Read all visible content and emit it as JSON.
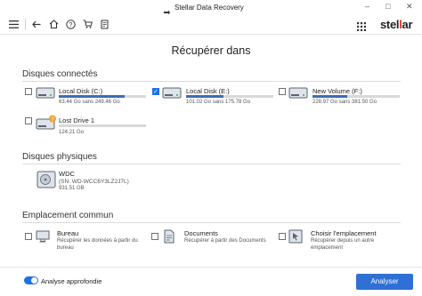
{
  "window": {
    "title": "Stellar Data Recovery",
    "minimize_glyph": "–",
    "maximize_glyph": "□",
    "close_glyph": "✕"
  },
  "toolbar": {
    "icons": [
      "menu-icon",
      "back-icon",
      "home-icon",
      "help-icon",
      "cart-icon",
      "settings-icon"
    ],
    "logo_main": "stel",
    "logo_accent": "l",
    "logo_end": "ar"
  },
  "page": {
    "heading": "Récupérer dans"
  },
  "connected": {
    "title": "Disques connectés",
    "drives": [
      {
        "name": "Local Disk (C:)",
        "sub": "63.44 Go sans 249.46 Go",
        "used_fraction": 0.75,
        "checked": false
      },
      {
        "name": "Local Disk (E:)",
        "sub": "101.02 Go sans 175.78 Go",
        "used_fraction": 0.43,
        "checked": true
      },
      {
        "name": "New Volume (F:)",
        "sub": "228.97 Go sans 381.50 Go",
        "used_fraction": 0.4,
        "checked": false
      },
      {
        "name": "Lost Drive 1",
        "sub": "124.21 Go",
        "used_fraction": 0,
        "checked": false
      }
    ]
  },
  "physical": {
    "title": "Disques physiques",
    "disk": {
      "name": "WDC",
      "model": "(SN: WD-WCC6Y3LZ2J7L)",
      "size": "931.51 GB"
    }
  },
  "common": {
    "title": "Emplacement commun",
    "items": [
      {
        "title": "Bureau",
        "desc1": "Récupérer les données à partir du",
        "desc2": "bureau",
        "desc3": ""
      },
      {
        "title": "Documents",
        "desc1": "Récupérer à partir des Documents",
        "desc2": "",
        "desc3": ""
      },
      {
        "title": "Choisir l'emplacement",
        "desc1": "Récupérer depuis un autre",
        "desc2": "emplacement",
        "desc3": ""
      }
    ]
  },
  "footer": {
    "toggle_label": "Analyse approfondie",
    "toggle_on": true,
    "scan_button": "Analyser"
  },
  "colors": {
    "accent": "#2f6fd6",
    "logo_red": "#d9382b",
    "bar_fill": "#3d6db5",
    "lost_badge": "#f0a030"
  }
}
